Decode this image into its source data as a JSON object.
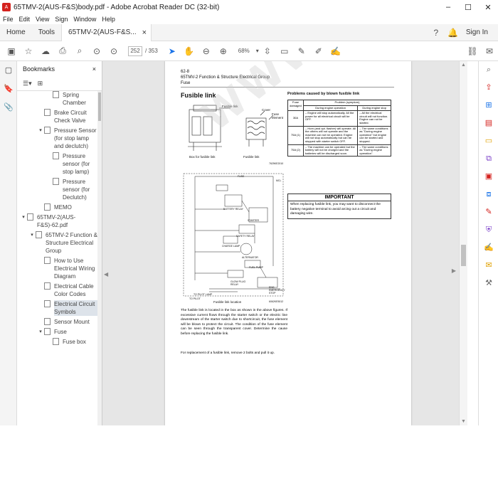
{
  "window": {
    "title": "65TMV-2(AUS-F&S)body.pdf - Adobe Acrobat Reader DC (32-bit)",
    "minimize": "–",
    "maximize": "☐",
    "close": "✕"
  },
  "menu": [
    "File",
    "Edit",
    "View",
    "Sign",
    "Window",
    "Help"
  ],
  "tabs": {
    "home": "Home",
    "tools": "Tools",
    "document": "65TMV-2(AUS-F&S...",
    "close": "×",
    "sign_in": "Sign In"
  },
  "toolbar": {
    "page_current": "252",
    "page_total": "/ 353",
    "zoom": "68%"
  },
  "bookmarks": {
    "title": "Bookmarks",
    "close": "×",
    "items": [
      {
        "label": "Spring Chamber",
        "indent": 3,
        "twisty": ""
      },
      {
        "label": "Brake Circuit Check Valve",
        "indent": 2,
        "twisty": ""
      },
      {
        "label": "Pressure Sensor (for stop lamp and declutch)",
        "indent": 2,
        "twisty": "▾"
      },
      {
        "label": "Pressure sensor (for stop lamp)",
        "indent": 3,
        "twisty": ""
      },
      {
        "label": "Pressure sensor (for Declutch)",
        "indent": 3,
        "twisty": ""
      },
      {
        "label": "MEMO",
        "indent": 2,
        "twisty": ""
      },
      {
        "label": "65TMV-2(AUS-F&S)-62.pdf",
        "indent": 0,
        "twisty": "▾"
      },
      {
        "label": "65TMV-2 Function & Structure Electrical Group",
        "indent": 1,
        "twisty": "▾"
      },
      {
        "label": "How to Use Electrical Wiring Diagram",
        "indent": 2,
        "twisty": ""
      },
      {
        "label": "Electrical Cable Color Codes",
        "indent": 2,
        "twisty": ""
      },
      {
        "label": "Electrical Circuit Symbols",
        "indent": 2,
        "twisty": "",
        "selected": true
      },
      {
        "label": "Sensor Mount",
        "indent": 2,
        "twisty": ""
      },
      {
        "label": "Fuse",
        "indent": 2,
        "twisty": "▾"
      },
      {
        "label": "Fuse box",
        "indent": 3,
        "twisty": ""
      }
    ]
  },
  "page": {
    "header_line1": "62-8",
    "header_line2": "65TMV-2 Function & Structure Electrical Group",
    "header_line3": "Fuse",
    "section_title": "Fusible link",
    "figure_label_fusible": "Fusible link",
    "figure_label_cover": "Cover",
    "figure_label_fuse_element": "Fuse element",
    "figure_caption_box": "Box for fusible link",
    "figure_caption_link": "Fusible link",
    "figure_code": "7625KE2010",
    "circuit_caption": "Fusible link location",
    "circuit_code": "6062KE5012",
    "circuit_labels": {
      "fuse": "FUSE",
      "mcl": "MCL",
      "battery_relay": "BATTERY RELAY",
      "starter": "STARTER",
      "safety_relay": "SAFETY RELAY",
      "charge_lamp": "CHARGE LAMP",
      "alternator": "ALTERNATOR",
      "fuel_pump": "FUEL PUMP",
      "glow_plug_relay": "GLOW PLUG RELAY",
      "eng_emergency_stop": "ENG EMERGENCY STOP",
      "to_pilot_lamp": "TO PILOT LAMP",
      "to_pilot": "TO PILOT"
    },
    "body_paragraph1": "The fusible link is located in the box as shown in the above figures. If excessive current flows through the starter switch or the electric line downstream of the starter switch due to shortcircuit, the fuse element will be blown to protect the circuit. The condition of the fuse element can be seen through the transparent cover. Determine the cause before replacing the fusible link.",
    "body_paragraph2": "For replacement of a fusible link, remove 2 bolts and pull it up.",
    "problems_title": "Problems caused by blown fusible link",
    "table": {
      "col_fuse": "Fuse damaged",
      "col_problem": "Problem (symptom)",
      "col_operation": "During engine operation",
      "col_stop": "During engine stop",
      "rows": [
        {
          "amp": "30A",
          "operation": "– Engine will stop automatically. All the power for all electrical circuit will be OFF.",
          "stop": "– All the electrical circuit will not function. Engine can not be started."
        },
        {
          "amp": "75A (1)",
          "operation": "– Horn (and opt. flasher) will operate. All the others will not operate and the machine can not be operated. Engine will not stop automatically but can be stopped with starter switch OFF.",
          "stop": "– The same conditions as \"During engine operation\" but engine can be started and stopped."
        },
        {
          "amp": "75A (2)",
          "operation": "– The machine can be operated but the battery will not be charged and the batteries will be discharged soon.",
          "stop": "– The same conditions as \"During engine operation\"."
        }
      ]
    },
    "important_title": "IMPORTANT",
    "important_body": "When replacing fusible link, you may want to disconnect the battery negative terminal to avoid arcing out a circuit and damaging wire."
  },
  "watermark": "WWW.EPCDEPOT.COM",
  "colors": {
    "accent": "#1a73e8",
    "panel_bg": "#f4f4f4",
    "doc_bg": "#e6e6e6"
  },
  "icons": {
    "left_rail": [
      "page-thumbnails-icon",
      "bookmarks-icon",
      "attachments-icon"
    ],
    "right_rail": [
      "export-pdf-icon",
      "create-pdf-icon",
      "edit-pdf-icon",
      "organize-pages-icon",
      "comment-icon",
      "combine-files-icon",
      "compress-pdf-icon",
      "redact-icon",
      "protect-icon",
      "fill-sign-icon",
      "send-for-comments-icon",
      "more-tools-icon"
    ]
  }
}
